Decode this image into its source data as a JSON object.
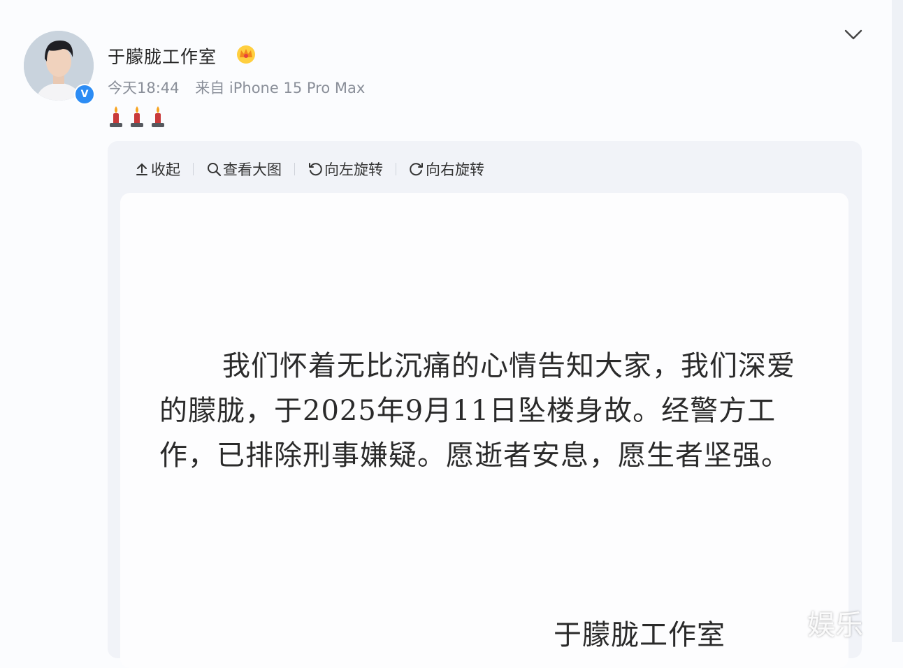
{
  "post": {
    "author": "于朦胧工作室",
    "time": "今天18:44",
    "source": "来自 iPhone 15 Pro Max",
    "body_icons": [
      "candle-icon",
      "candle-icon",
      "candle-icon"
    ],
    "badge_icon": "crown-icon",
    "verified_label": "V"
  },
  "toolbar": {
    "collapse": "收起",
    "view_large": "查看大图",
    "rotate_left": "向左旋转",
    "rotate_right": "向右旋转"
  },
  "image": {
    "statement": "我们怀着无比沉痛的心情告知大家，我们深爱的朦胧，于2025年9月11日坠楼身故。经警方工作，已排除刑事嫌疑。愿逝者安息，愿生者坚强。",
    "signature": "于朦胧工作室",
    "watermark": "娱乐"
  },
  "colors": {
    "verified": "#2c8cf4",
    "panel": "#f1f3f8",
    "meta_text": "#8a8f99"
  }
}
